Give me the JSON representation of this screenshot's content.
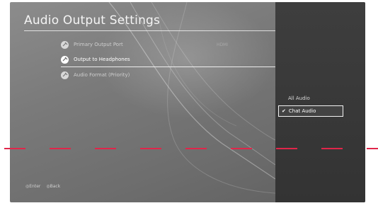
{
  "screen": {
    "title": "Audio Output Settings"
  },
  "menu": {
    "items": [
      {
        "label": "Primary Output Port",
        "value": "HDMI"
      },
      {
        "label": "Output to Headphones",
        "value": ""
      },
      {
        "label": "Audio Format (Priority)",
        "value": ""
      }
    ]
  },
  "options": {
    "items": [
      {
        "label": "All Audio"
      },
      {
        "label": "Chat Audio"
      }
    ]
  },
  "footer": {
    "enter": "Enter",
    "back": "Back"
  },
  "colors": {
    "panel": "#3a3a3a",
    "dash": "#e0264a",
    "highlight": "#ffffff"
  }
}
